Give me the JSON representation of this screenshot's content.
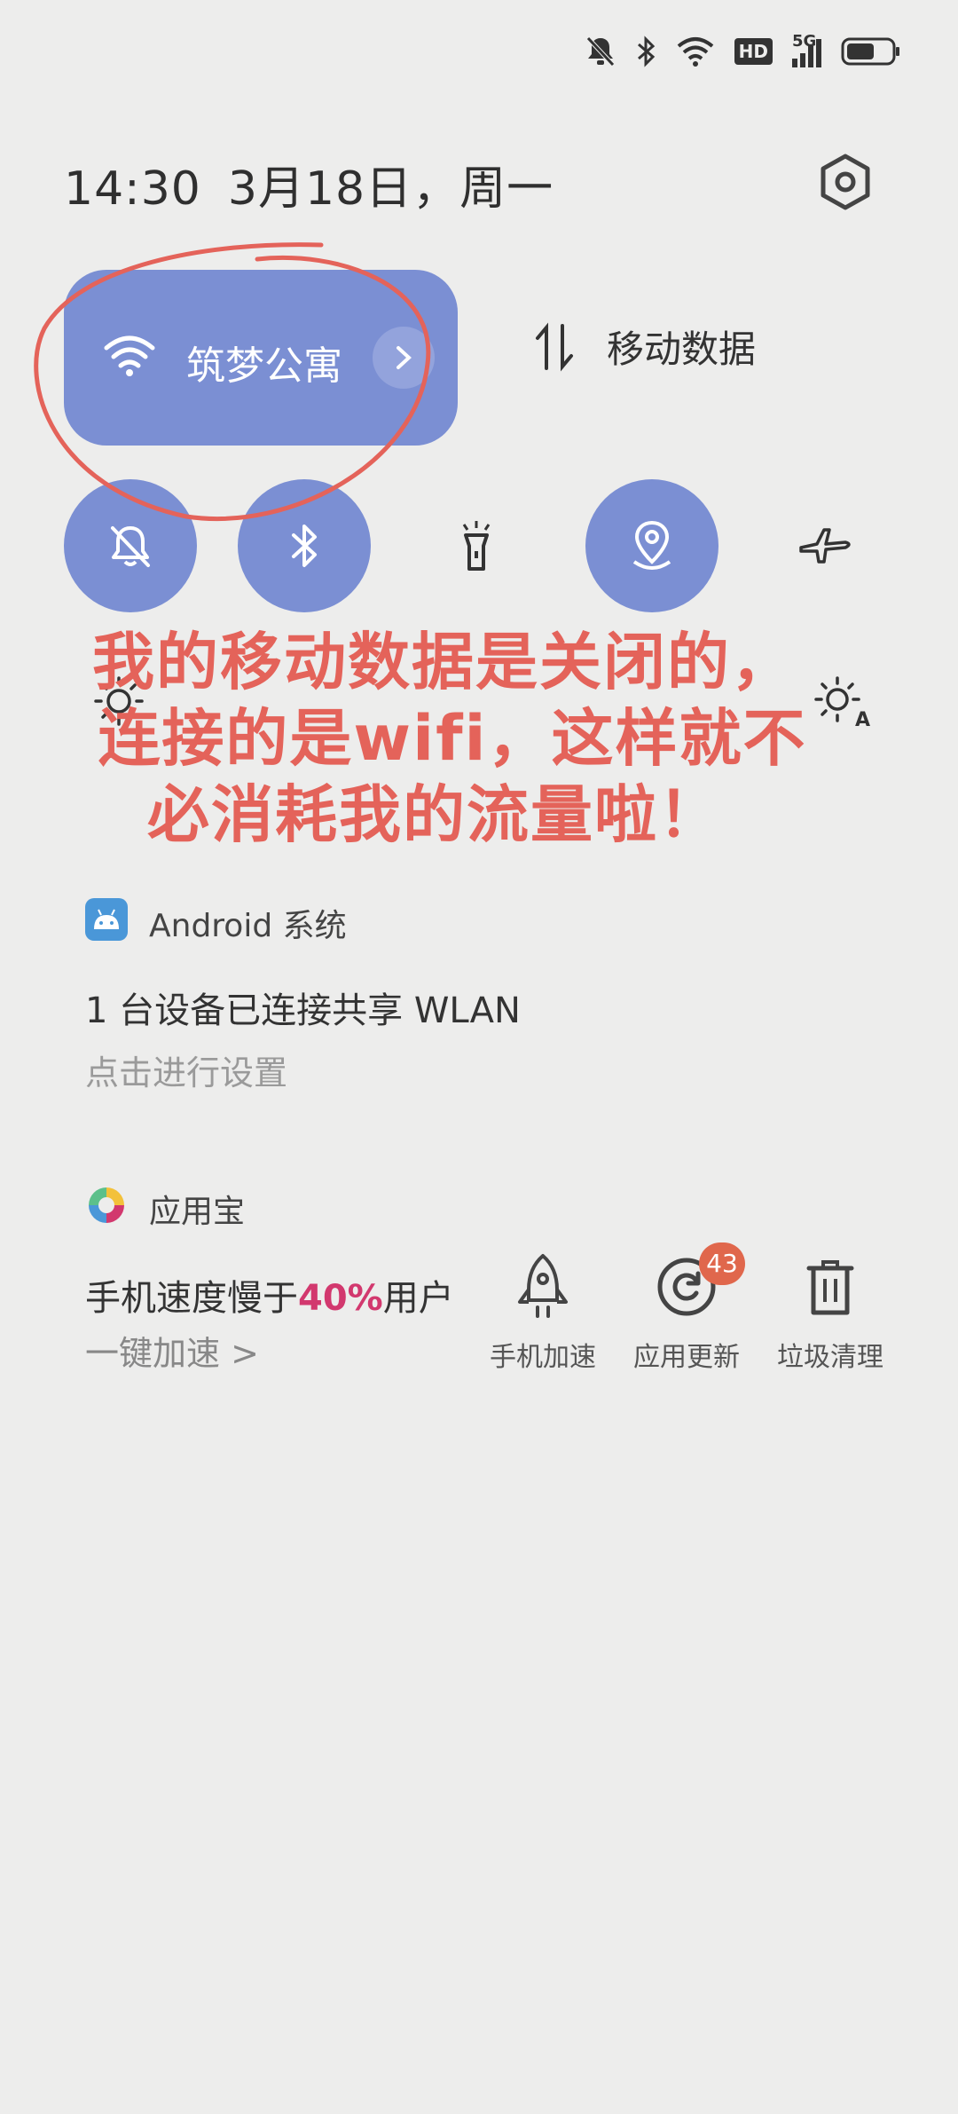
{
  "status_bar": {
    "icons": [
      "mute-icon",
      "bluetooth-icon",
      "wifi-icon",
      "hd-icon",
      "5g-signal-icon",
      "battery-icon"
    ],
    "hd_label": "HD",
    "net_label": "5G"
  },
  "header": {
    "time": "14:30",
    "date": "3月18日，周一"
  },
  "tiles": {
    "wifi_label": "筑梦公寓",
    "mobile_label": "移动数据",
    "wifi_active": true,
    "mobile_active": false
  },
  "quick_buttons": [
    {
      "icon": "mute-bell-icon",
      "active": true
    },
    {
      "icon": "bluetooth-icon",
      "active": true
    },
    {
      "icon": "flashlight-icon",
      "active": false
    },
    {
      "icon": "location-icon",
      "active": true
    },
    {
      "icon": "airplane-icon",
      "active": false
    }
  ],
  "annotation": {
    "line1": "我的移动数据是关闭的，",
    "line2": "连接的是wifi，这样就不",
    "line3": "必消耗我的流量啦！",
    "color": "#e4635a"
  },
  "notifications": {
    "android": {
      "app": "Android 系统",
      "title": "1 台设备已连接共享 WLAN",
      "subtitle": "点击进行设置"
    },
    "yyb": {
      "app": "应用宝",
      "title_pre": "手机速度慢于",
      "title_highlight": "40%",
      "title_post": "用户",
      "subtitle": "一键加速 >",
      "actions": [
        {
          "label": "手机加速",
          "icon": "rocket-icon"
        },
        {
          "label": "应用更新",
          "icon": "refresh-icon",
          "badge": "43"
        },
        {
          "label": "垃圾清理",
          "icon": "trash-icon"
        }
      ]
    }
  },
  "colors": {
    "accent": "#7b8fd3",
    "background": "#ededec",
    "highlight": "#d2386e",
    "badge": "#e0674c"
  }
}
